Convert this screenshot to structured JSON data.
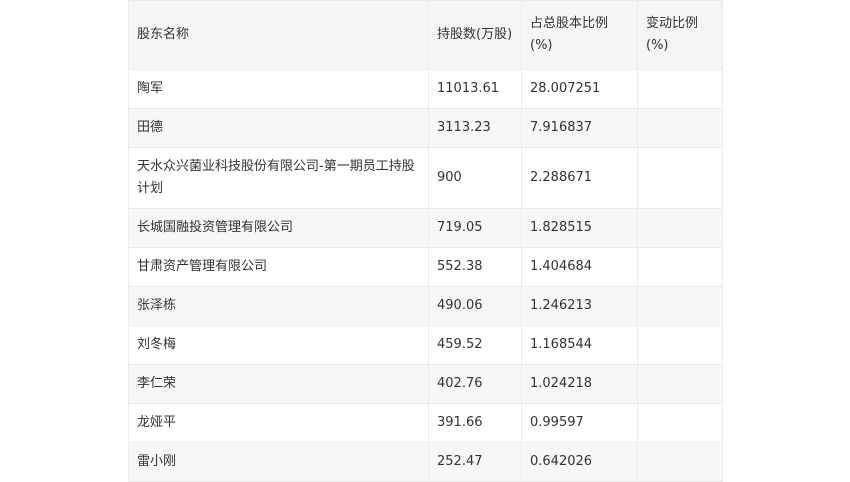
{
  "table": {
    "headers": [
      "股东名称",
      "持股数(万股)",
      "占总股本比例(%)",
      "变动比例(%)"
    ],
    "rows": [
      [
        "陶军",
        "11013.61",
        "28.007251",
        ""
      ],
      [
        "田德",
        "3113.23",
        "7.916837",
        ""
      ],
      [
        "天水众兴菌业科技股份有限公司-第一期员工持股计划",
        "900",
        "2.288671",
        ""
      ],
      [
        "长城国融投资管理有限公司",
        "719.05",
        "1.828515",
        ""
      ],
      [
        "甘肃资产管理有限公司",
        "552.38",
        "1.404684",
        ""
      ],
      [
        "张泽栋",
        "490.06",
        "1.246213",
        ""
      ],
      [
        "刘冬梅",
        "459.52",
        "1.168544",
        ""
      ],
      [
        "李仁荣",
        "402.76",
        "1.024218",
        ""
      ],
      [
        "龙娅平",
        "391.66",
        "0.99597",
        ""
      ],
      [
        "雷小刚",
        "252.47",
        "0.642026",
        ""
      ]
    ]
  }
}
